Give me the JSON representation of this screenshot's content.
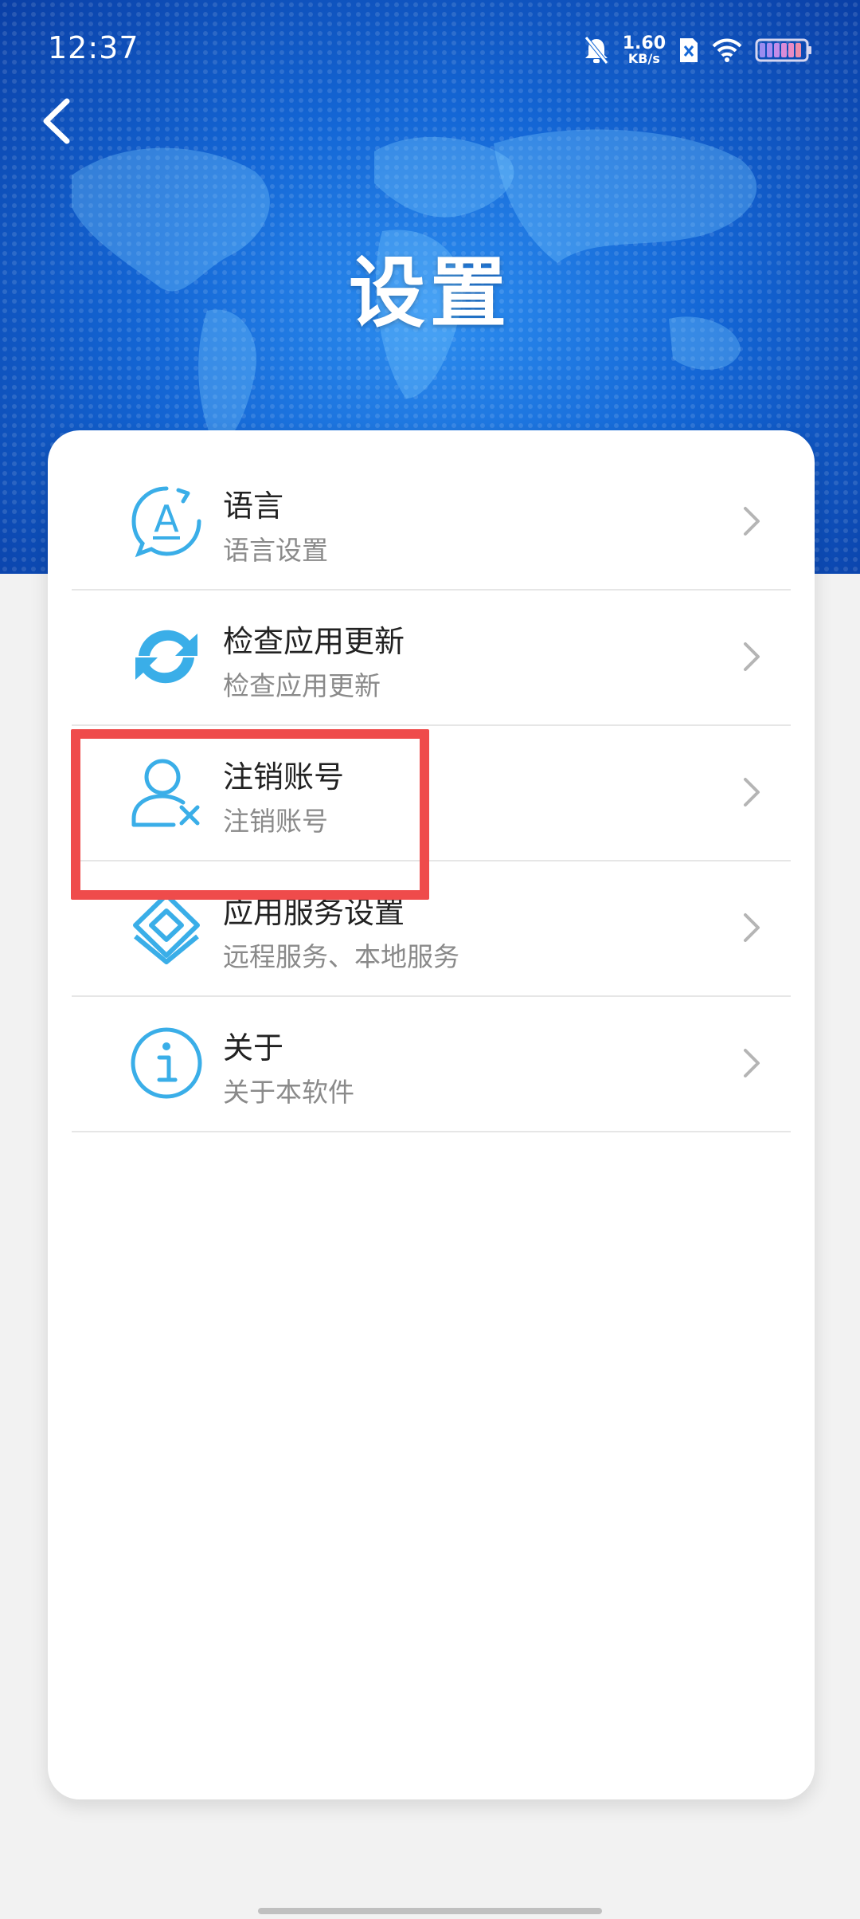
{
  "status_bar": {
    "time": "12:37",
    "net_speed_value": "1.60",
    "net_speed_unit": "KB/s",
    "icons": [
      "bell-muted-icon",
      "sim-x-icon",
      "wifi-icon",
      "battery-icon"
    ]
  },
  "header": {
    "title": "设置",
    "back_icon": "chevron-left-icon"
  },
  "menu": {
    "items": [
      {
        "title": "语言",
        "subtitle": "语言设置",
        "icon": "language-icon"
      },
      {
        "title": "检查应用更新",
        "subtitle": "检查应用更新",
        "icon": "refresh-icon"
      },
      {
        "title": "注销账号",
        "subtitle": "注销账号",
        "icon": "user-remove-icon"
      },
      {
        "title": "应用服务设置",
        "subtitle": "远程服务、本地服务",
        "icon": "layers-icon"
      },
      {
        "title": "关于",
        "subtitle": "关于本软件",
        "icon": "info-icon"
      }
    ]
  },
  "colors": {
    "header_blue": "#1467d6",
    "icon_blue": "#3aaee8",
    "highlight_red": "#ef4b4b",
    "chevron_gray": "#b5b5b5"
  }
}
